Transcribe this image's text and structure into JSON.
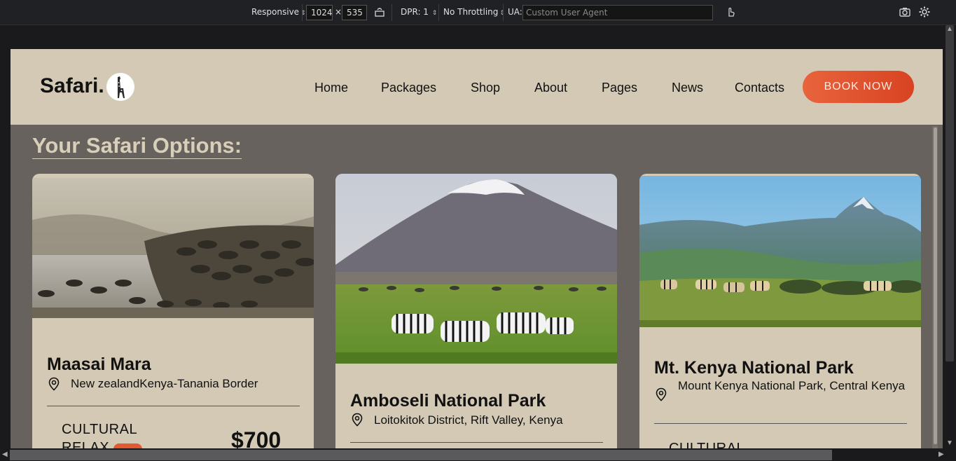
{
  "devtools": {
    "device": "Responsive",
    "width": "1024",
    "times": "×",
    "height": "535",
    "dpr": "DPR: 1",
    "throttling": "No Throttling",
    "ua_label": "UA:",
    "ua_placeholder": "Custom User Agent"
  },
  "site": {
    "logo": "Safari.",
    "nav": [
      "Home",
      "Packages",
      "Shop",
      "About",
      "Pages",
      "News",
      "Contacts"
    ],
    "book_button": "BOOK NOW",
    "section_title": "Your Safari Options:"
  },
  "cards": [
    {
      "name": "Maasai Mara",
      "location": "New zealandKenya-Tanania Border",
      "category_line1": "CULTURAL",
      "category_line2": "RELAX",
      "price": "$700"
    },
    {
      "name": "Amboseli National Park",
      "location": "Loitokitok District, Rift Valley, Kenya"
    },
    {
      "name": "Mt. Kenya National Park",
      "location": "Mount Kenya National Park, Central Kenya",
      "category_line1": "CULTURAL"
    }
  ],
  "colors": {
    "nav_bg": "#d3c9b4",
    "page_bg": "#67625d",
    "accent": "#e05430"
  }
}
